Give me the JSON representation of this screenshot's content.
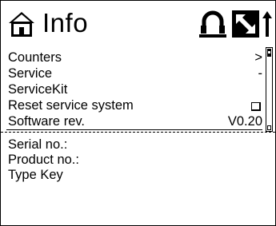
{
  "header": {
    "title": "Info",
    "icons": [
      "home-icon",
      "headset-icon",
      "tool-icon",
      "up-arrow-icon"
    ]
  },
  "menu": {
    "items": [
      {
        "label": "Counters",
        "value": ">"
      },
      {
        "label": "Service",
        "value": "-"
      },
      {
        "label": "ServiceKit",
        "value": ""
      },
      {
        "label": "Reset service system",
        "value": ""
      },
      {
        "label": "Software rev.",
        "value": "V0.20"
      }
    ]
  },
  "info": {
    "items": [
      {
        "label": "Serial no.:"
      },
      {
        "label": "Product no.:"
      },
      {
        "label": "Type Key"
      }
    ]
  }
}
